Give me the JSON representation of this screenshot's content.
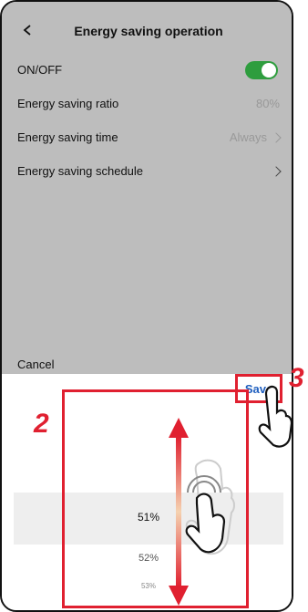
{
  "header": {
    "title": "Energy saving operation"
  },
  "rows": [
    {
      "label": "ON/OFF",
      "value": "",
      "type": "toggle"
    },
    {
      "label": "Energy saving ratio",
      "value": "80%",
      "type": "value"
    },
    {
      "label": "Energy saving time",
      "value": "Always",
      "type": "chevron-value"
    },
    {
      "label": "Energy saving schedule",
      "value": "",
      "type": "chevron"
    }
  ],
  "toggle_on": true,
  "sheet": {
    "cancel_label": "Cancel",
    "save_label": "Save"
  },
  "picker": {
    "options": [
      "51%",
      "52%",
      "53%"
    ],
    "selected": "51%"
  },
  "callouts": {
    "step2": "2",
    "step3": "3"
  },
  "colors": {
    "accent": "#e02030",
    "toggle": "#2e9d3e",
    "save": "#1f5fbf"
  }
}
